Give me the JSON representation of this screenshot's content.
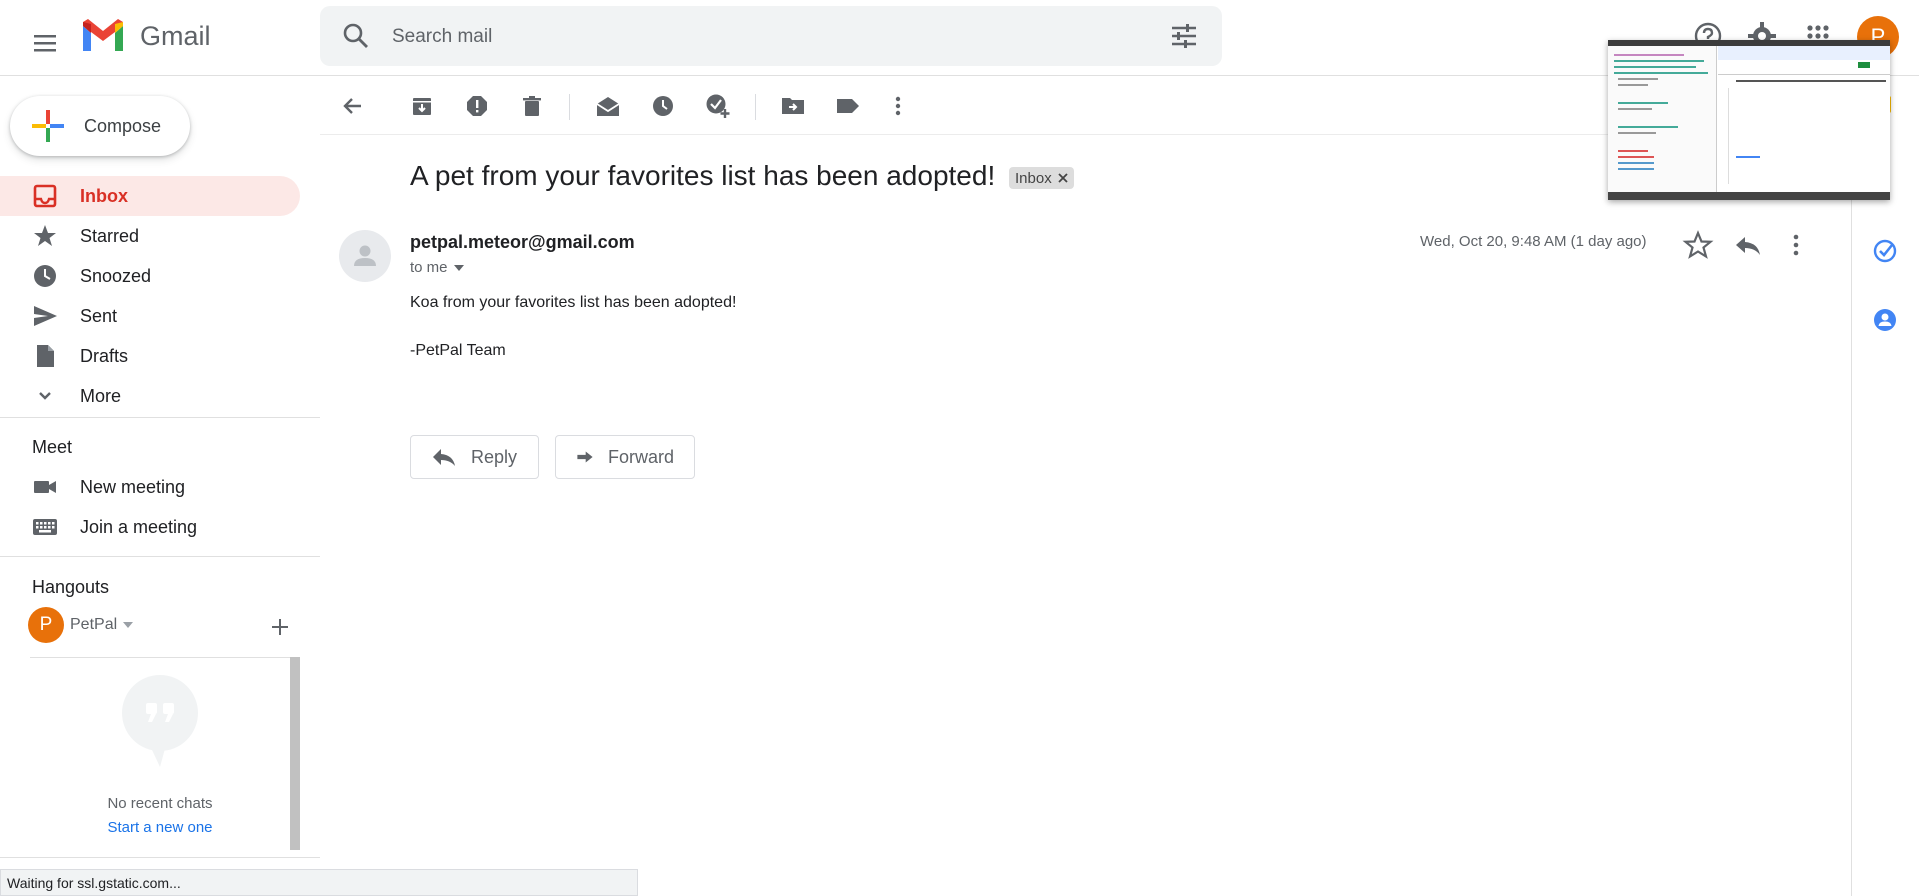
{
  "app": {
    "name": "Gmail"
  },
  "search": {
    "placeholder": "Search mail"
  },
  "header": {
    "avatar_letter": "P"
  },
  "compose": {
    "label": "Compose"
  },
  "nav": {
    "items": [
      {
        "label": "Inbox"
      },
      {
        "label": "Starred"
      },
      {
        "label": "Snoozed"
      },
      {
        "label": "Sent"
      },
      {
        "label": "Drafts"
      },
      {
        "label": "More"
      }
    ]
  },
  "meet": {
    "title": "Meet",
    "new_meeting": "New meeting",
    "join_meeting": "Join a meeting"
  },
  "hangouts": {
    "title": "Hangouts",
    "user_letter": "P",
    "user_name": "PetPal",
    "no_chats": "No recent chats",
    "start_new": "Start a new one"
  },
  "message": {
    "subject": "A pet from your favorites list has been adopted!",
    "label": "Inbox",
    "sender": "petpal.meteor@gmail.com",
    "recipient": "to me",
    "date": "Wed, Oct 20, 9:48 AM (1 day ago)",
    "body": [
      "Koa from your favorites list has been adopted!",
      "-PetPal Team"
    ]
  },
  "actions": {
    "reply": "Reply",
    "forward": "Forward"
  },
  "status": {
    "text": "Waiting for ssl.gstatic.com..."
  },
  "colors": {
    "accent_red": "#d93025",
    "avatar_orange": "#e8710a",
    "link_blue": "#1a73e8"
  }
}
